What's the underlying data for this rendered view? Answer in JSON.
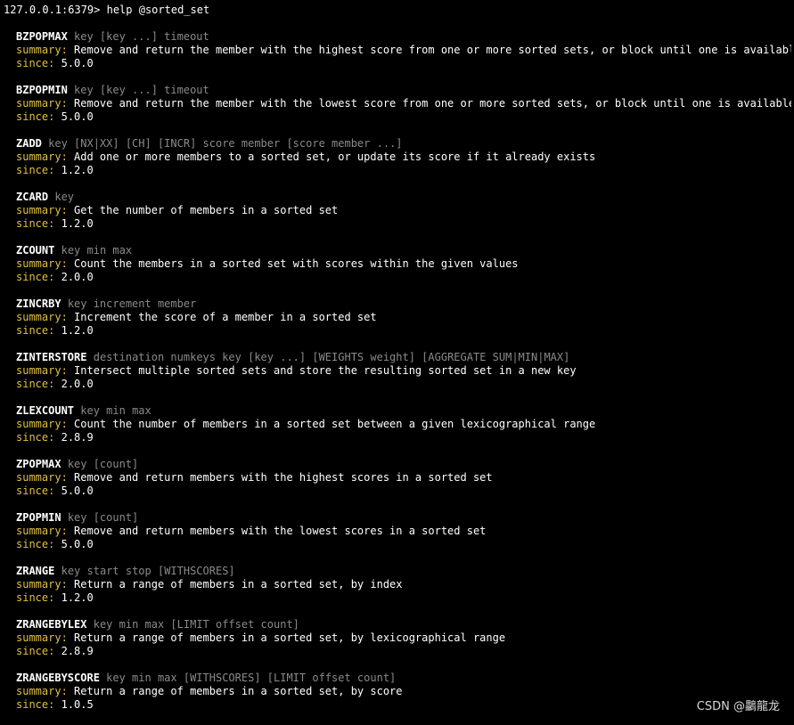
{
  "prompt": {
    "host": "127.0.0.1:6379>",
    "command": "help @sorted_set"
  },
  "labels": {
    "summary": "summary:",
    "since": "since:"
  },
  "commands": [
    {
      "name": "BZPOPMAX",
      "args": "key [key ...] timeout",
      "summary": "Remove and return the member with the highest score from one or more sorted sets, or block until one is available",
      "since": "5.0.0"
    },
    {
      "name": "BZPOPMIN",
      "args": "key [key ...] timeout",
      "summary": "Remove and return the member with the lowest score from one or more sorted sets, or block until one is available",
      "since": "5.0.0"
    },
    {
      "name": "ZADD",
      "args": "key [NX|XX] [CH] [INCR] score member [score member ...]",
      "summary": "Add one or more members to a sorted set, or update its score if it already exists",
      "since": "1.2.0"
    },
    {
      "name": "ZCARD",
      "args": "key",
      "summary": "Get the number of members in a sorted set",
      "since": "1.2.0"
    },
    {
      "name": "ZCOUNT",
      "args": "key min max",
      "summary": "Count the members in a sorted set with scores within the given values",
      "since": "2.0.0"
    },
    {
      "name": "ZINCRBY",
      "args": "key increment member",
      "summary": "Increment the score of a member in a sorted set",
      "since": "1.2.0"
    },
    {
      "name": "ZINTERSTORE",
      "args": "destination numkeys key [key ...] [WEIGHTS weight] [AGGREGATE SUM|MIN|MAX]",
      "summary": "Intersect multiple sorted sets and store the resulting sorted set in a new key",
      "since": "2.0.0"
    },
    {
      "name": "ZLEXCOUNT",
      "args": "key min max",
      "summary": "Count the number of members in a sorted set between a given lexicographical range",
      "since": "2.8.9"
    },
    {
      "name": "ZPOPMAX",
      "args": "key [count]",
      "summary": "Remove and return members with the highest scores in a sorted set",
      "since": "5.0.0"
    },
    {
      "name": "ZPOPMIN",
      "args": "key [count]",
      "summary": "Remove and return members with the lowest scores in a sorted set",
      "since": "5.0.0"
    },
    {
      "name": "ZRANGE",
      "args": "key start stop [WITHSCORES]",
      "summary": "Return a range of members in a sorted set, by index",
      "since": "1.2.0"
    },
    {
      "name": "ZRANGEBYLEX",
      "args": "key min max [LIMIT offset count]",
      "summary": "Return a range of members in a sorted set, by lexicographical range",
      "since": "2.8.9"
    },
    {
      "name": "ZRANGEBYSCORE",
      "args": "key min max [WITHSCORES] [LIMIT offset count]",
      "summary": "Return a range of members in a sorted set, by score",
      "since": "1.0.5"
    }
  ],
  "watermark": "CSDN @鸓龍龙",
  "colors": {
    "background": "#000000",
    "text": "#ffffff",
    "args": "#8a8a8a",
    "label": "#e0c040"
  }
}
